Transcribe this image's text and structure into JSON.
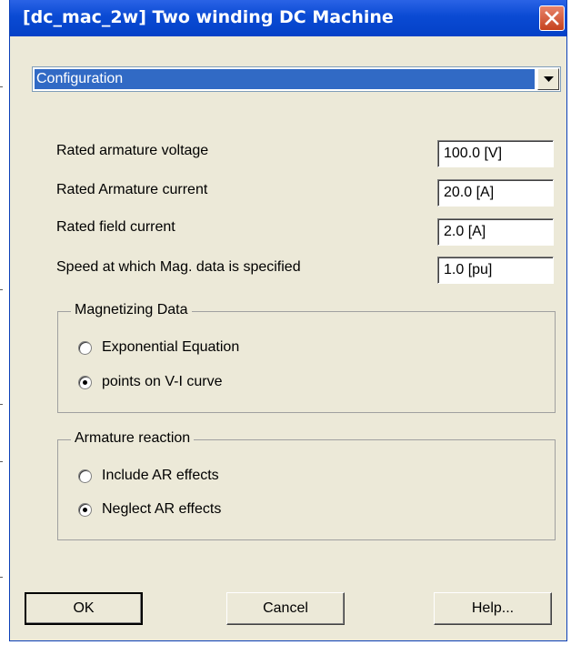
{
  "window": {
    "title": "[dc_mac_2w] Two winding DC Machine",
    "close_icon": "close-x-icon"
  },
  "page_selector": {
    "selected": "Configuration",
    "arrow_icon": "chevron-down-icon"
  },
  "params": [
    {
      "label": "Rated armature voltage",
      "value": "100.0 [V]"
    },
    {
      "label": "Rated Armature current",
      "value": "20.0 [A]"
    },
    {
      "label": "Rated field current",
      "value": "2.0 [A]"
    },
    {
      "label": "Speed at which Mag. data is specified",
      "value": "1.0 [pu]"
    }
  ],
  "magnetizing": {
    "title": "Magnetizing Data",
    "options": [
      {
        "label": "Exponential Equation",
        "checked": false
      },
      {
        "label": "points on V-I curve",
        "checked": true
      }
    ]
  },
  "armature_reaction": {
    "title": "Armature reaction",
    "options": [
      {
        "label": "Include AR effects",
        "checked": false
      },
      {
        "label": "Neglect AR effects",
        "checked": true
      }
    ]
  },
  "buttons": {
    "ok": "OK",
    "cancel": "Cancel",
    "help": "Help..."
  },
  "colors": {
    "titlebar": "#0a4ad3",
    "dialog_bg": "#ece9d8",
    "selection": "#316ac5",
    "close_button": "#c5421e"
  }
}
